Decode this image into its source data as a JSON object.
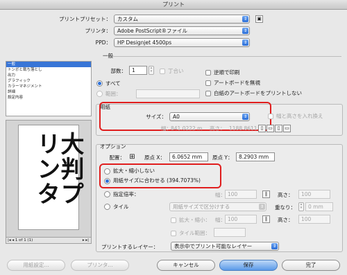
{
  "window": {
    "title": "プリント"
  },
  "top": {
    "preset_label": "プリントプリセット：",
    "preset_value": "カスタム",
    "printer_label": "プリンタ：",
    "printer_value": "Adobe PostScript®ファイル",
    "ppd_label": "PPD：",
    "ppd_value": "HP Designjet 4500ps"
  },
  "sidebar": {
    "items": [
      "一般",
      "トンボと裁ち落とし",
      "出力",
      "グラフィック",
      "カラーマネジメント",
      "詳細",
      "設定内容"
    ],
    "selected": "一般"
  },
  "preview": {
    "text": "大判プリンタ",
    "page_indicator": "1 of 1 (1)"
  },
  "general": {
    "section_title": "一般",
    "copies_label": "部数：",
    "copies_value": "1",
    "collate_label": "丁合い",
    "reverse_label": "逆順で印刷",
    "all_label": "すべて",
    "range_label": "範囲：",
    "ignore_artboard_label": "アートボードを無視",
    "skip_blank_label": "白紙のアートボードをプリントしない"
  },
  "paper": {
    "section_title": "用紙",
    "size_label": "サイズ：",
    "size_value": "A0",
    "width_label": "幅：",
    "width_value": "841.0222 m",
    "height_label": "高さ：",
    "height_value": "1188.8611",
    "transverse_label": "幅と高さを入れ換え"
  },
  "options": {
    "section_title": "オプション",
    "placement_label": "配置：",
    "origin_x_label": "原点 X：",
    "origin_x_value": "6.0652 mm",
    "origin_y_label": "原点 Y：",
    "origin_y_value": "8.2903 mm",
    "no_scale_label": "拡大・縮小しない",
    "fit_label": "用紙サイズに合わせる (394.7073%)",
    "custom_scale_label": "指定倍率：",
    "custom_w_label": "幅：",
    "custom_w_value": "100",
    "custom_h_label": "高さ：",
    "custom_h_value": "100",
    "tile_label": "タイル",
    "tile_popup_value": "用紙サイズで区分けする",
    "overlap_label": "重なり：",
    "overlap_value": "0 mm",
    "tile_scale_label": "拡大・縮小：",
    "tile_w_label": "幅：",
    "tile_w_value": "100",
    "tile_h_label": "高さ：",
    "tile_h_value": "100",
    "tile_range_label": "タイル範囲：",
    "layers_label": "プリントするレイヤー：",
    "layers_value": "表示中でプリント可能なレイヤー"
  },
  "footer": {
    "page_setup_label": "用紙設定...",
    "printer_label": "プリンタ...",
    "cancel_label": "キャンセル",
    "save_label": "保存",
    "done_label": "完了"
  },
  "colors": {
    "accent": "#2a6ed8",
    "highlight": "#e01e1e"
  }
}
